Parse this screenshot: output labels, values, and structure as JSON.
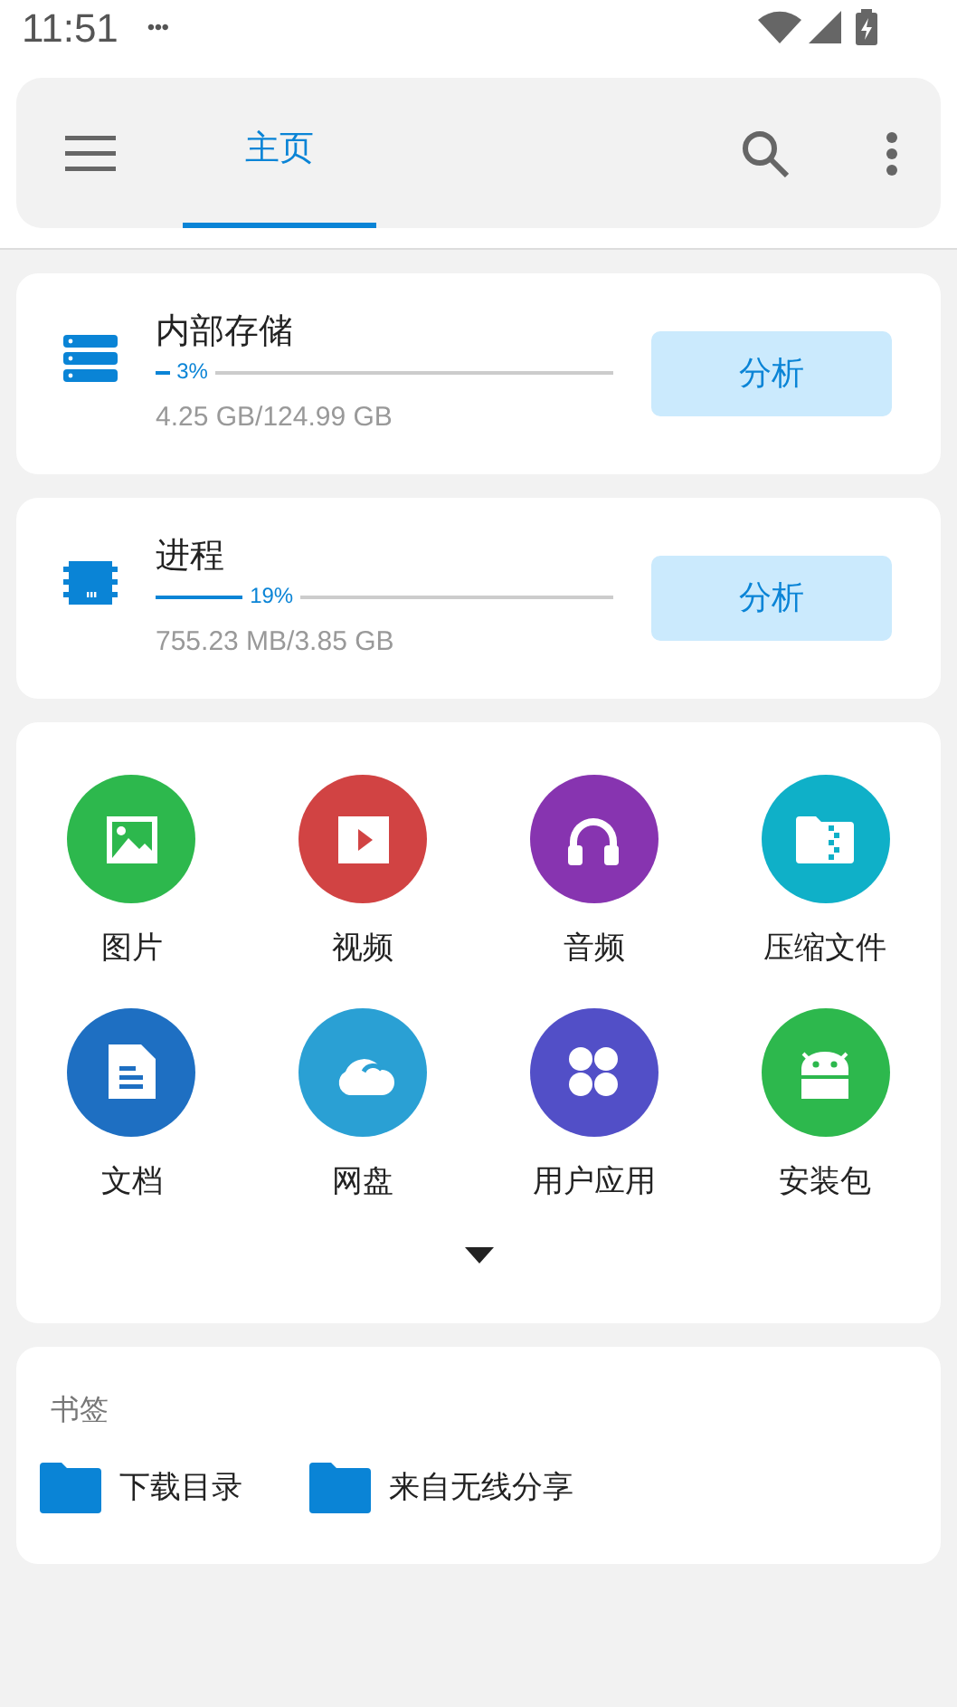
{
  "status_bar": {
    "time": "11:51",
    "more": "•••"
  },
  "toolbar": {
    "tabs": [
      {
        "label": "主页",
        "selected": true
      }
    ]
  },
  "storage": [
    {
      "kind": "storage",
      "title": "内部存储",
      "level": 0.03,
      "percent": "3%",
      "usage": "4.25 GB/124.99 GB",
      "button": "分析"
    },
    {
      "kind": "memory",
      "title": "进程",
      "level": 0.19,
      "percent": "19%",
      "usage": "755.23 MB/3.85 GB",
      "button": "分析"
    }
  ],
  "categories": [
    {
      "kind": "image",
      "label": "图片",
      "color": "#2db84d"
    },
    {
      "kind": "video",
      "label": "视频",
      "color": "#d14343"
    },
    {
      "kind": "audio",
      "label": "音频",
      "color": "#8734b0"
    },
    {
      "kind": "archive",
      "label": "压缩文件",
      "color": "#0fb0c8"
    },
    {
      "kind": "document",
      "label": "文档",
      "color": "#1e6fc2"
    },
    {
      "kind": "cloud",
      "label": "网盘",
      "color": "#2aa0d4"
    },
    {
      "kind": "apps",
      "label": "用户应用",
      "color": "#524fc7"
    },
    {
      "kind": "package",
      "label": "安装包",
      "color": "#2db84d"
    }
  ],
  "bookmarks": {
    "title": "书签",
    "items": [
      {
        "label": "下载目录"
      },
      {
        "label": "来自无线分享"
      }
    ]
  }
}
